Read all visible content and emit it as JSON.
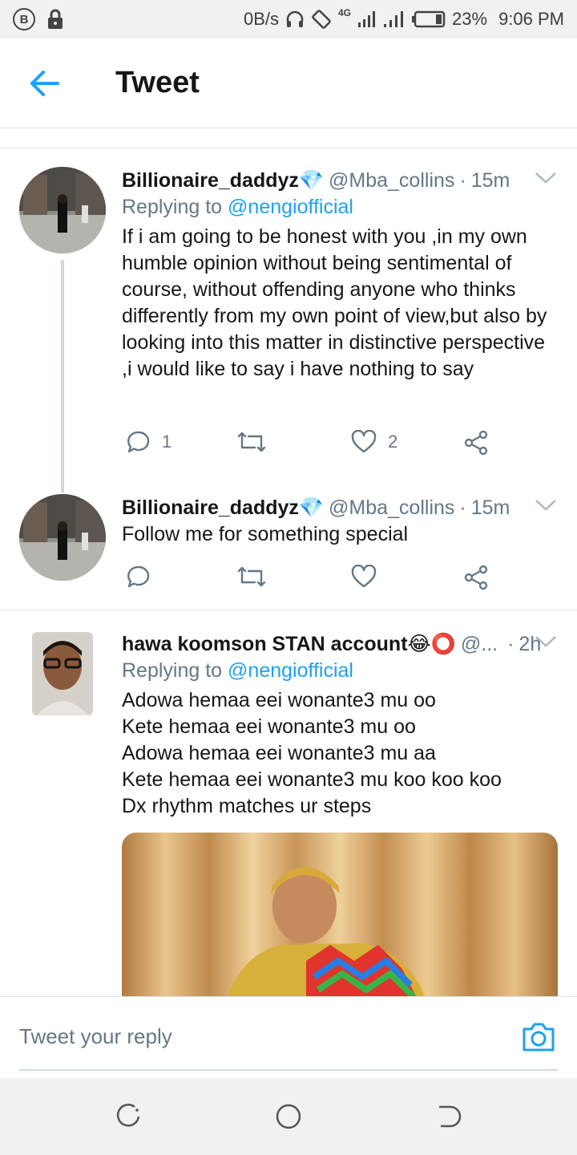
{
  "status_bar": {
    "speed": "0B/s",
    "network": "4G",
    "battery": "23%",
    "time": "9:06 PM"
  },
  "header": {
    "title": "Tweet"
  },
  "tweets": [
    {
      "name": "Billionaire_daddyz💎",
      "handle": "@Mba_collins",
      "dot": "·",
      "time": "15m",
      "replying_prefix": "Replying to",
      "replying_to": "@nengiofficial",
      "text": "If i am going to be honest with you ,in my own humble opinion without being sentimental of course, without offending anyone who thinks differently from my own point of view,but also by looking into this matter in distinctive perspective ,i would like to say i have nothing to say",
      "replies": "1",
      "likes": "2"
    },
    {
      "name": "Billionaire_daddyz💎",
      "handle": "@Mba_collins",
      "dot": "·",
      "time": "15m",
      "text": "Follow me for something special"
    },
    {
      "name": "hawa koomson STAN account😂⭕",
      "handle": "@...",
      "dot": "·",
      "time": "2h",
      "replying_prefix": "Replying to",
      "replying_to": "@nengiofficial",
      "text": "Adowa hemaa eei wonante3 mu oo\nKete hemaa eei wonante3 mu oo\nAdowa hemaa eei wonante3 mu aa\nKete hemaa eei wonante3 mu koo koo koo\nDx rhythm matches ur steps"
    }
  ],
  "reply_bar": {
    "placeholder": "Tweet your reply"
  },
  "colors": {
    "accent": "#1da1f2",
    "secondary_text": "#657786",
    "divider": "#dfe3e6"
  }
}
